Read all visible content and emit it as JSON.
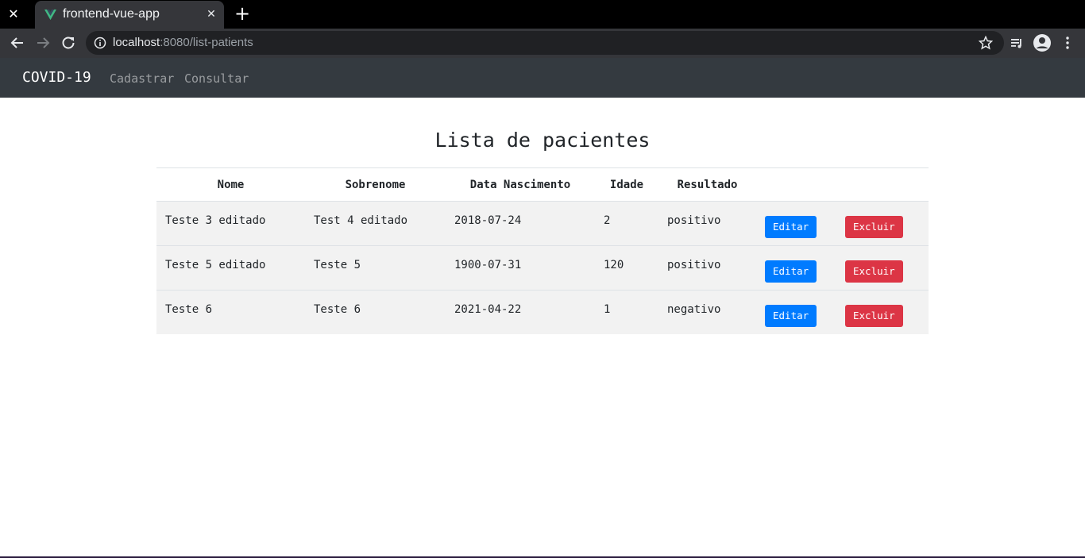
{
  "browser": {
    "tab_title": "frontend-vue-app",
    "url_host": "localhost",
    "url_path": ":8080/list-patients"
  },
  "navbar": {
    "brand": "COVID-19",
    "links": [
      "Cadastrar",
      "Consultar"
    ]
  },
  "main": {
    "title": "Lista de pacientes",
    "table": {
      "headers": [
        "Nome",
        "Sobrenome",
        "Data Nascimento",
        "Idade",
        "Resultado"
      ],
      "rows": [
        [
          "Teste 3 editado",
          "Test 4 editado",
          "2018-07-24",
          "2",
          "positivo"
        ],
        [
          "Teste 5 editado",
          "Teste 5",
          "1900-07-31",
          "120",
          "positivo"
        ],
        [
          "Teste 6",
          "Teste 6",
          "2021-04-22",
          "1",
          "negativo"
        ]
      ],
      "edit_label": "Editar",
      "delete_label": "Excluir"
    }
  },
  "colors": {
    "navbar_bg": "#343a40",
    "edit_button": "#007bff",
    "delete_button": "#dc3545",
    "row_bg": "#f2f2f2"
  },
  "icons": [
    "close-icon",
    "vue-logo-icon",
    "plus-icon",
    "back-arrow-icon",
    "forward-arrow-icon",
    "reload-icon",
    "info-icon",
    "star-icon",
    "media-queue-icon",
    "profile-icon",
    "menu-dots-icon"
  ]
}
